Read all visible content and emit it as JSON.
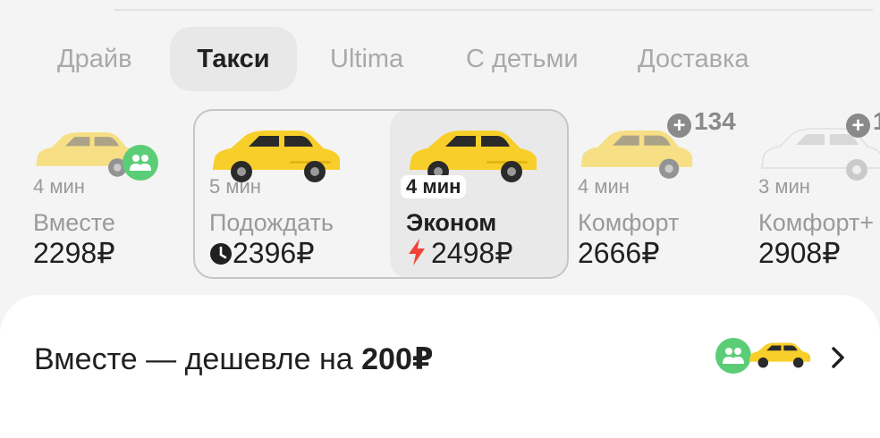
{
  "tabs": [
    {
      "label": "Драйв",
      "active": false
    },
    {
      "label": "Такси",
      "active": true
    },
    {
      "label": "Ultima",
      "active": false
    },
    {
      "label": "С детьми",
      "active": false
    },
    {
      "label": "Доставка",
      "active": false
    }
  ],
  "tariffs": [
    {
      "eta": "4 мин",
      "name": "Вместе",
      "price": "2298₽"
    },
    {
      "eta": "5 мин",
      "name": "Подождать",
      "price": "2396₽",
      "price_icon": "clock-icon"
    },
    {
      "eta": "4 мин",
      "name": "Эконом",
      "price": "2498₽",
      "price_icon": "lightning-icon",
      "selected": true
    },
    {
      "eta": "4 мин",
      "name": "Комфорт",
      "price": "2666₽",
      "badge": "134"
    },
    {
      "eta": "3 мин",
      "name": "Комфорт+",
      "price": "2908₽",
      "badge": "1"
    }
  ],
  "banner": {
    "text": "Вместе — дешевле на ",
    "amount": "200₽"
  },
  "colors": {
    "car_yellow": "#f8cf2a",
    "car_white": "#f4f4f4",
    "lightning": "#f0443a",
    "people_green": "#5ccd77"
  }
}
